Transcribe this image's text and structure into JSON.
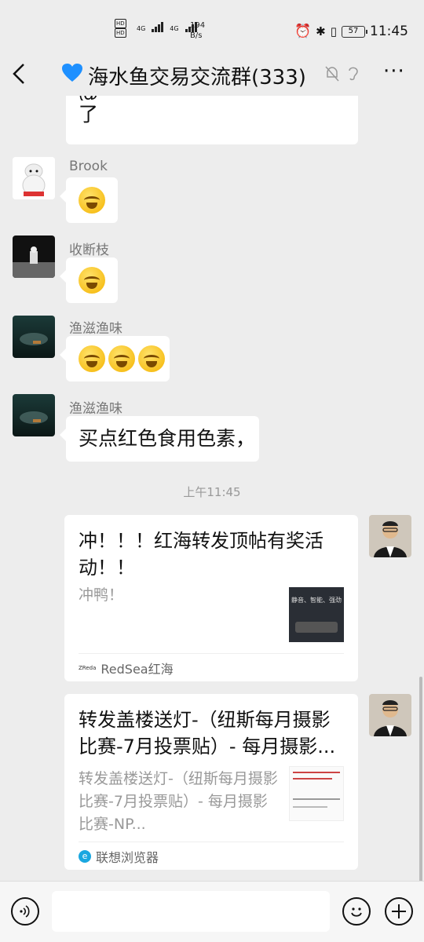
{
  "status_bar": {
    "net_label_1": "HD",
    "net_label_2": "HD",
    "net_4g_1": "4G",
    "net_4g_2": "4G",
    "speed_value": "194",
    "speed_unit": "B/s",
    "battery": "57",
    "time": "11:45"
  },
  "header": {
    "back_icon": "chevron-left-icon",
    "title": "海水鱼交易交流群(333)",
    "mute_icon": "bell-off-icon",
    "ear_icon": "ear-icon",
    "more_icon": "more-dots-icon"
  },
  "messages": [
    {
      "sender": "",
      "text_line1": "@",
      "text_line2": "了"
    },
    {
      "sender": "Brook",
      "emoji_count": 1
    },
    {
      "sender": "收断枝",
      "emoji_count": 1
    },
    {
      "sender": "渔滋渔味",
      "emoji_count": 3
    },
    {
      "sender": "渔滋渔味",
      "text": "买点红色食用色素，"
    }
  ],
  "timestamp": "上午11:45",
  "cards": [
    {
      "title": "冲！！！红海转发顶帖有奖活动！！",
      "desc": "冲鸭！",
      "thumb_text_1": "静音、智能、强劲",
      "source": "RedSea红海",
      "source_icon_text": "ZReda"
    },
    {
      "title": "转发盖楼送灯-（纽斯每月摄影比赛-7月投票贴）- 每月摄影...",
      "desc": "转发盖楼送灯-（纽斯每月摄影比赛-7月投票贴）- 每月摄影比赛-NP...",
      "source": "联想浏览器"
    }
  ],
  "input": {
    "voice_icon": "voice-icon",
    "emoji_icon": "smiley-icon",
    "plus_icon": "plus-icon",
    "value": ""
  }
}
